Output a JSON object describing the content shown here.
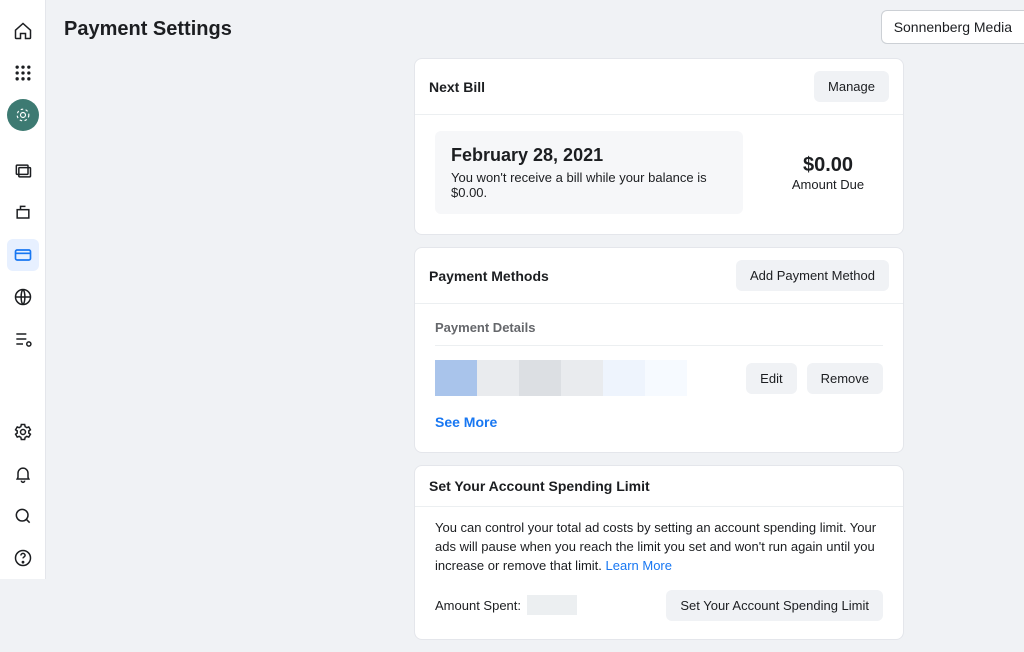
{
  "page": {
    "title": "Payment Settings"
  },
  "account": {
    "name": "Sonnenberg Media"
  },
  "nextBill": {
    "header": "Next Bill",
    "manage": "Manage",
    "date": "February 28, 2021",
    "note": "You won't receive a bill while your balance is $0.00.",
    "amount": "$0.00",
    "amountLabel": "Amount Due"
  },
  "paymentMethods": {
    "header": "Payment Methods",
    "add": "Add Payment Method",
    "detailsLabel": "Payment Details",
    "edit": "Edit",
    "remove": "Remove",
    "seeMore": "See More"
  },
  "spendingLimit": {
    "header": "Set Your Account Spending Limit",
    "text": "You can control your total ad costs by setting an account spending limit. Your ads will pause when you reach the limit you set and won't run again until you increase or remove that limit. ",
    "learnMore": "Learn More",
    "amountSpentLabel": "Amount Spent:",
    "button": "Set Your Account Spending Limit"
  }
}
